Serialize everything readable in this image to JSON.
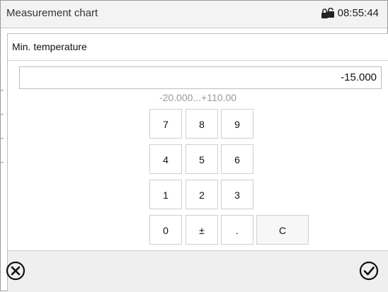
{
  "window": {
    "title": "Measurement chart",
    "time": "08:55:44",
    "lock_icon": "lock-icon"
  },
  "dialog": {
    "title": "Min. temperature",
    "value": "-15.000",
    "range": "-20.000...+110.00"
  },
  "keypad": {
    "rows": [
      [
        "7",
        "8",
        "9"
      ],
      [
        "4",
        "5",
        "6"
      ],
      [
        "1",
        "2",
        "3"
      ],
      [
        "0",
        "±",
        ".",
        "C"
      ]
    ]
  },
  "footer": {
    "cancel_icon": "cancel-icon",
    "confirm_icon": "confirm-icon"
  }
}
